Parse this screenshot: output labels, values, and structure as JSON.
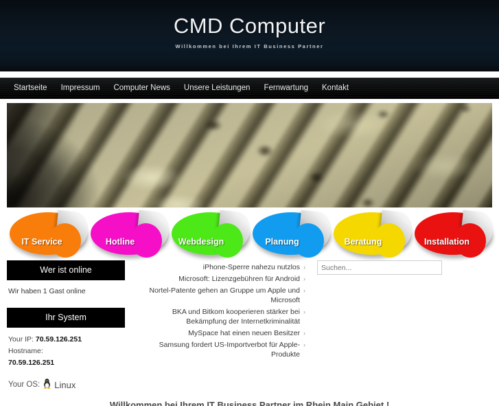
{
  "header": {
    "title": "CMD Computer",
    "tagline": "Willkommen bei Ihrem IT Business Partner"
  },
  "nav": {
    "items": [
      {
        "label": "Startseite"
      },
      {
        "label": "Impressum"
      },
      {
        "label": "Computer News"
      },
      {
        "label": "Unsere Leistungen"
      },
      {
        "label": "Fernwartung"
      },
      {
        "label": "Kontakt"
      }
    ]
  },
  "banner": {
    "alt": "keyboard-closeup-photo"
  },
  "stickers": [
    {
      "label": "IT Service",
      "color": "#f97d0a"
    },
    {
      "label": "Hotline",
      "color": "#f510c8"
    },
    {
      "label": "Webdesign",
      "color": "#4de817"
    },
    {
      "label": "Planung",
      "color": "#129cf0"
    },
    {
      "label": "Beratung",
      "color": "#f5d800"
    },
    {
      "label": "Installation",
      "color": "#ea1111"
    }
  ],
  "sidebar": {
    "online": {
      "heading": "Wer ist online",
      "text": "Wir haben 1 Gast online"
    },
    "system": {
      "heading": "Ihr System",
      "ip_label": "Your IP:",
      "ip_value": "70.59.126.251",
      "hostname_label": "Hostname:",
      "hostname_value": "70.59.126.251",
      "os_label": "Your OS:",
      "os_value": "Linux"
    }
  },
  "news": {
    "items": [
      {
        "title": "iPhone-Sperre nahezu nutzlos",
        "marker": "›"
      },
      {
        "title": "Microsoft: Lizenzgebühren für Android",
        "marker": "›"
      },
      {
        "title": "Nortel-Patente gehen an Gruppe um Apple und Microsoft",
        "marker": "›"
      },
      {
        "title": "BKA und Bitkom kooperieren stärker bei Bekämpfung der Internetkriminalität",
        "marker": "›"
      },
      {
        "title": "MySpace hat einen neuen Besitzer",
        "marker": "›"
      },
      {
        "title": "Samsung fordert US-Importverbot für Apple-Produkte",
        "marker": "›"
      }
    ]
  },
  "search": {
    "placeholder": "Suchen...",
    "value": ""
  },
  "main": {
    "welcome_heading": "Willkommen bei Ihrem IT Business Partner im Rhein Main Gebiet !"
  }
}
